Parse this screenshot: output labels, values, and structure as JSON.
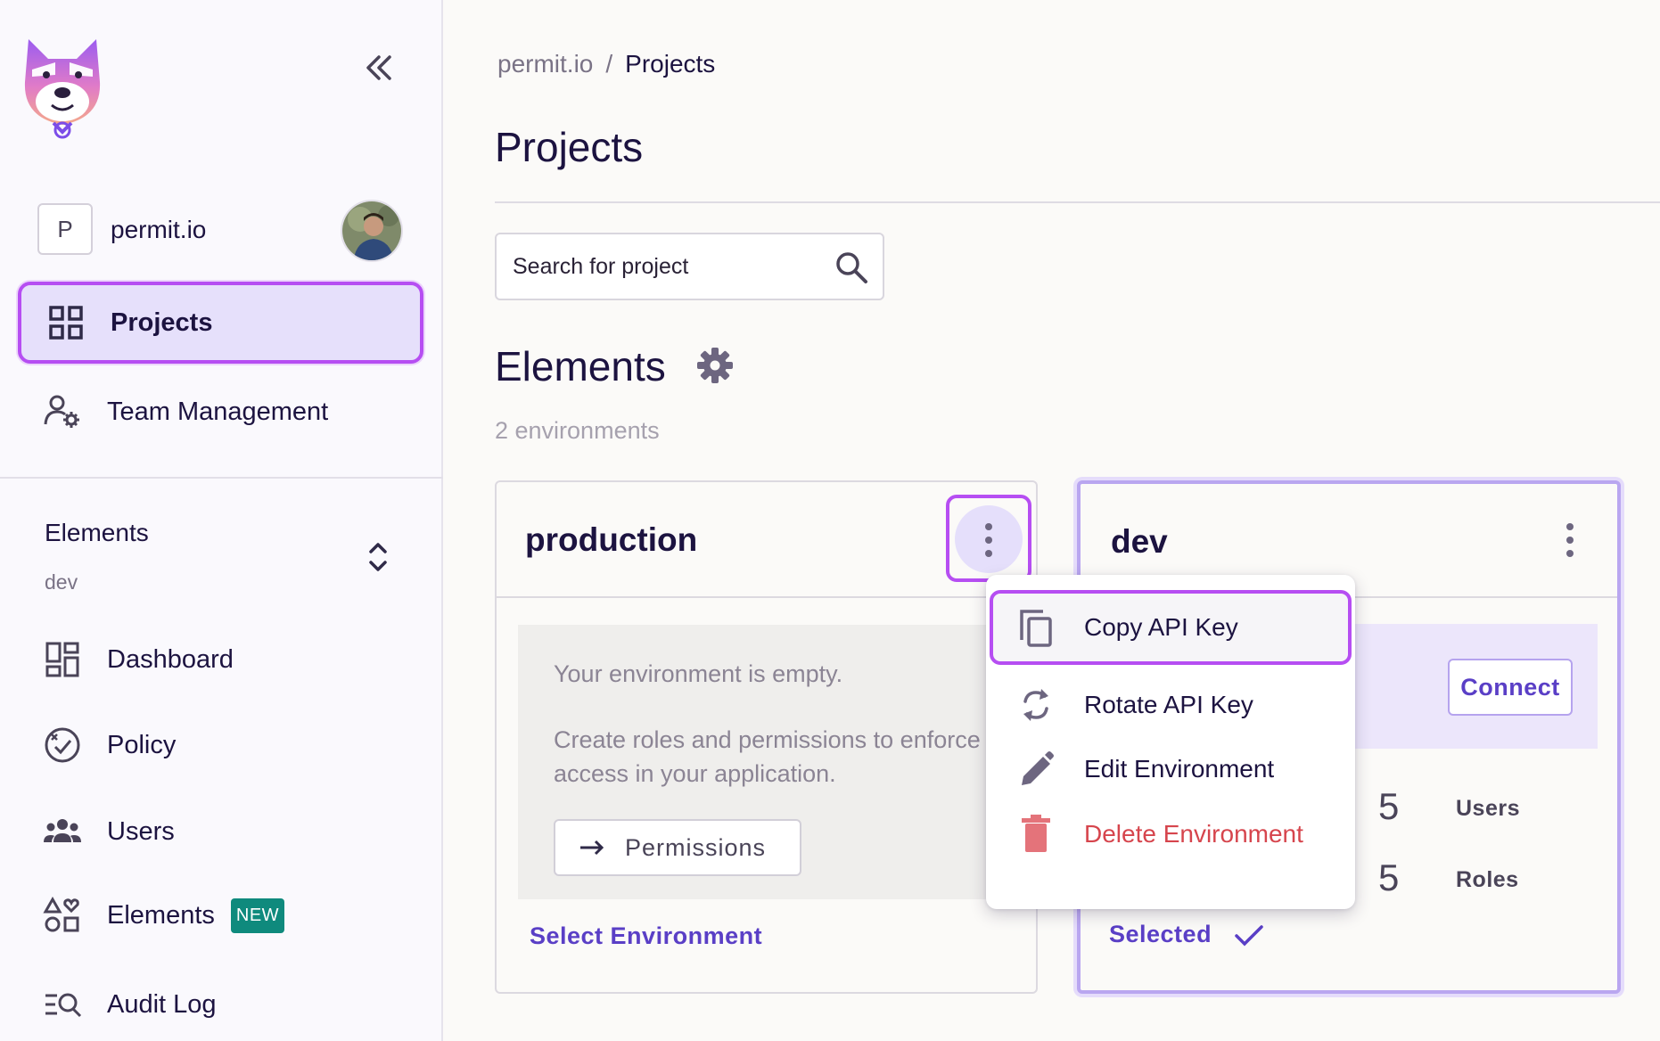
{
  "sidebar": {
    "org_initial": "P",
    "org_name": "permit.io",
    "nav": [
      {
        "label": "Projects",
        "icon": "grid-icon",
        "active": true
      },
      {
        "label": "Team Management",
        "icon": "team-settings-icon",
        "active": false
      }
    ],
    "env_selector": {
      "title": "Elements",
      "subtitle": "dev"
    },
    "env_nav": [
      {
        "label": "Dashboard",
        "icon": "dashboard-icon"
      },
      {
        "label": "Policy",
        "icon": "policy-icon"
      },
      {
        "label": "Users",
        "icon": "users-icon"
      },
      {
        "label": "Elements",
        "icon": "elements-icon",
        "badge": "NEW"
      },
      {
        "label": "Audit Log",
        "icon": "audit-log-icon"
      }
    ]
  },
  "breadcrumb": {
    "root": "permit.io",
    "separator": "/",
    "current": "Projects"
  },
  "page_title": "Projects",
  "search": {
    "placeholder": "Search for project",
    "value": ""
  },
  "project": {
    "name": "Elements",
    "env_count": "2 environments",
    "environments": [
      {
        "name": "production",
        "empty_title": "Your environment is empty.",
        "empty_desc": "Create roles and permissions to enforce access in your application.",
        "permissions_button": "Permissions",
        "select_link": "Select Environment"
      },
      {
        "name": "dev",
        "connect_button": "Connect",
        "stats": [
          {
            "value": "5",
            "label": "Users"
          },
          {
            "value": "5",
            "label": "Roles"
          }
        ],
        "selected_label": "Selected"
      }
    ]
  },
  "menu": {
    "items": [
      {
        "label": "Copy API Key",
        "icon": "copy-icon"
      },
      {
        "label": "Rotate API Key",
        "icon": "rotate-icon"
      },
      {
        "label": "Edit Environment",
        "icon": "pencil-icon"
      },
      {
        "label": "Delete Environment",
        "icon": "trash-icon"
      }
    ]
  },
  "colors": {
    "accent": "#5a3fc6",
    "highlight": "#b64ef2",
    "danger": "#d6454d",
    "badge": "#0f8a7d"
  }
}
